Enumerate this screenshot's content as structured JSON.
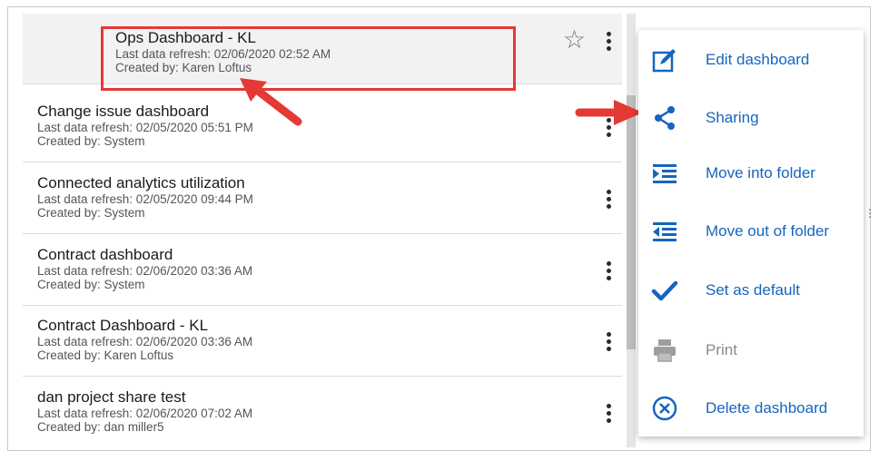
{
  "dashboards": [
    {
      "title": "Ops Dashboard - KL",
      "refresh": "Last data refresh: 02/06/2020 02:52 AM",
      "creator": "Created by: Karen Loftus"
    },
    {
      "title": "Change issue dashboard",
      "refresh": "Last data refresh: 02/05/2020 05:51 PM",
      "creator": "Created by: System"
    },
    {
      "title": "Connected analytics utilization",
      "refresh": "Last data refresh: 02/05/2020 09:44 PM",
      "creator": "Created by: System"
    },
    {
      "title": "Contract dashboard",
      "refresh": "Last data refresh: 02/06/2020 03:36 AM",
      "creator": "Created by: System"
    },
    {
      "title": "Contract Dashboard - KL",
      "refresh": "Last data refresh: 02/06/2020 03:36 AM",
      "creator": "Created by: Karen Loftus"
    },
    {
      "title": "dan project share test",
      "refresh": "Last data refresh: 02/06/2020 07:02 AM",
      "creator": "Created by: dan miller5"
    }
  ],
  "menu": {
    "items": [
      {
        "label": "Edit dashboard",
        "icon": "edit-icon",
        "enabled": true
      },
      {
        "label": "Sharing",
        "icon": "share-icon",
        "enabled": true
      },
      {
        "label": "Move into folder",
        "icon": "move-into-folder-icon",
        "enabled": true
      },
      {
        "label": "Move out of folder",
        "icon": "move-out-of-folder-icon",
        "enabled": true
      },
      {
        "label": "Set as default",
        "icon": "checkmark-icon",
        "enabled": true
      },
      {
        "label": "Print",
        "icon": "print-icon",
        "enabled": false
      },
      {
        "label": "Delete dashboard",
        "icon": "delete-circle-icon",
        "enabled": true
      }
    ]
  },
  "colors": {
    "accent": "#1565c0",
    "highlight": "#e53935",
    "arrow": "#e53935"
  }
}
